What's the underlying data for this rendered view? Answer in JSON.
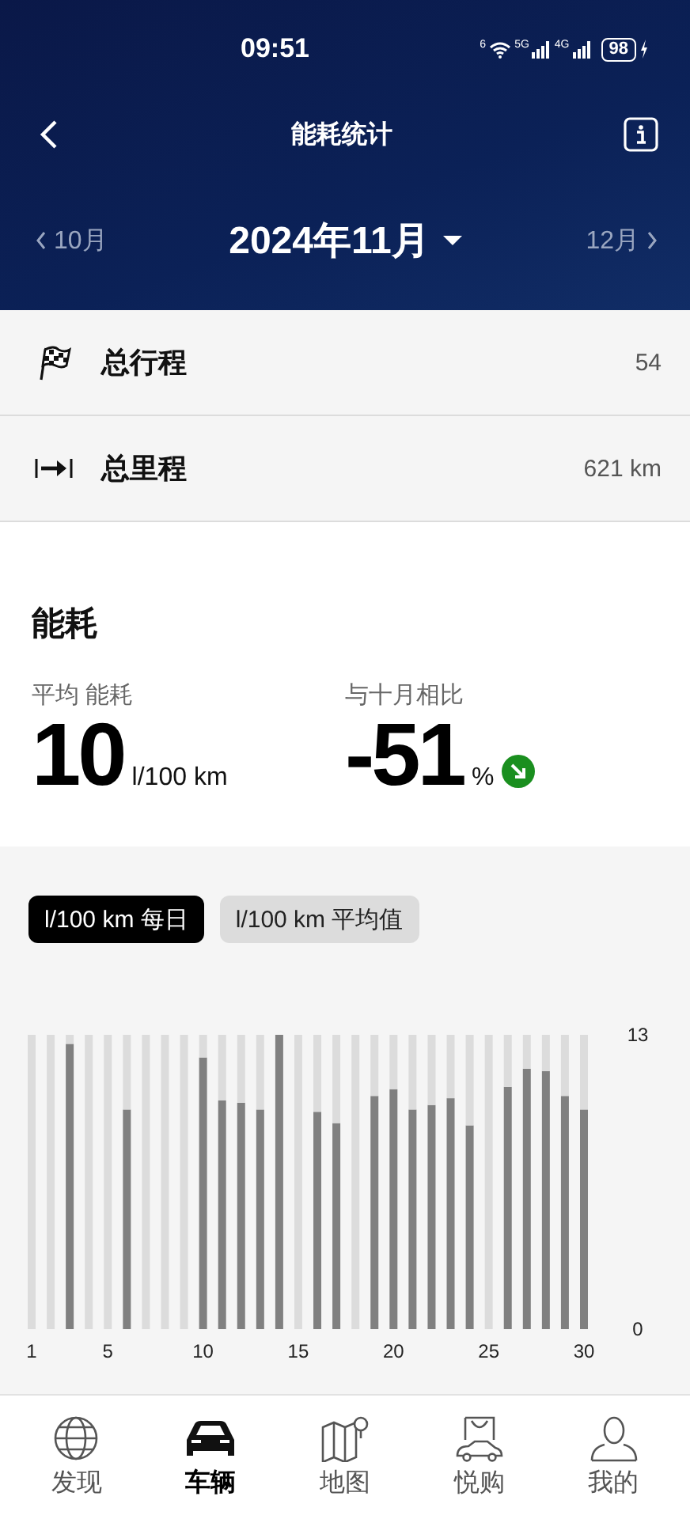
{
  "status_bar": {
    "time": "09:51",
    "wifi_label": "6",
    "networks": [
      "5G",
      "4G"
    ],
    "battery": "98"
  },
  "header": {
    "title": "能耗统计",
    "prev_month": "10月",
    "current_month": "2024年11月",
    "next_month": "12月"
  },
  "summary": [
    {
      "label": "总行程",
      "value": "54"
    },
    {
      "label": "总里程",
      "value": "621 km"
    }
  ],
  "consumption": {
    "title": "能耗",
    "average_label": "平均 能耗",
    "average_value": "10",
    "average_unit": "l/100 km",
    "compare_label": "与十月相比",
    "compare_value": "-51",
    "compare_unit": "%"
  },
  "chart_tabs": [
    {
      "label": "l/100 km 每日",
      "selected": true
    },
    {
      "label": "l/100 km 平均值",
      "selected": false
    }
  ],
  "chart_data": {
    "type": "bar",
    "x": [
      1,
      2,
      3,
      4,
      5,
      6,
      7,
      8,
      9,
      10,
      11,
      12,
      13,
      14,
      15,
      16,
      17,
      18,
      19,
      20,
      21,
      22,
      23,
      24,
      25,
      26,
      27,
      28,
      29,
      30
    ],
    "series": [
      {
        "color": "#808080",
        "values": [
          null,
          null,
          12.6,
          null,
          null,
          9.7,
          null,
          null,
          null,
          12.0,
          10.1,
          10.0,
          9.7,
          13.0,
          null,
          9.6,
          9.1,
          null,
          10.3,
          10.6,
          9.7,
          9.9,
          10.2,
          9.0,
          null,
          10.7,
          11.5,
          11.4,
          10.3,
          9.7
        ]
      },
      {
        "color": "#dcdcdc",
        "values": [
          13,
          13,
          0.4,
          13,
          13,
          3.3,
          13,
          13,
          13,
          1.0,
          2.9,
          3.0,
          3.3,
          null,
          13,
          3.4,
          3.9,
          13,
          2.7,
          2.4,
          3.3,
          3.1,
          2.8,
          4.0,
          13,
          2.3,
          1.5,
          1.6,
          2.7,
          3.3
        ]
      }
    ],
    "xlim": [
      1,
      30
    ],
    "ylim": [
      0,
      13
    ],
    "stacked": true,
    "yticks": [
      0,
      13
    ],
    "xticks": [
      1,
      5,
      10,
      15,
      20,
      25,
      30
    ]
  },
  "bottom_nav": [
    {
      "label": "发现",
      "selected": false
    },
    {
      "label": "车辆",
      "selected": true
    },
    {
      "label": "地图",
      "selected": false
    },
    {
      "label": "悦购",
      "selected": false
    },
    {
      "label": "我的",
      "selected": false
    }
  ]
}
